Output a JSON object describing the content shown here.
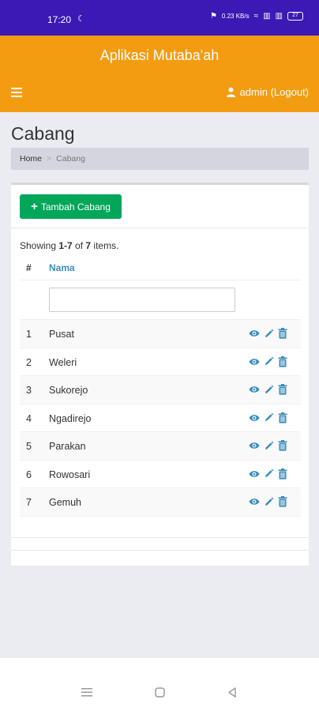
{
  "status_bar": {
    "time": "17:20",
    "net_speed": "0.23 KB/s",
    "battery": "27"
  },
  "header": {
    "app_title": "Aplikasi Mutaba'ah",
    "user_link": "admin (Logout)"
  },
  "page": {
    "title": "Cabang",
    "breadcrumb": {
      "home": "Home",
      "separator": ">",
      "current": "Cabang"
    }
  },
  "toolbar": {
    "add_label": "Tambah Cabang"
  },
  "summary": {
    "prefix": "Showing ",
    "range": "1-7",
    "of": " of ",
    "total": "7",
    "suffix": " items."
  },
  "table": {
    "headers": {
      "num": "#",
      "name": "Nama"
    },
    "filter_value": "",
    "rows": [
      {
        "num": "1",
        "name": "Pusat"
      },
      {
        "num": "2",
        "name": "Weleri"
      },
      {
        "num": "3",
        "name": "Sukorejo"
      },
      {
        "num": "4",
        "name": "Ngadirejo"
      },
      {
        "num": "5",
        "name": "Parakan"
      },
      {
        "num": "6",
        "name": "Rowosari"
      },
      {
        "num": "7",
        "name": "Gemuh"
      }
    ]
  },
  "colors": {
    "status_bar": "#3a19b4",
    "header": "#f39c12",
    "add_button": "#00a65a",
    "link": "#3c8dbc"
  },
  "icons": {
    "view": "eye-icon",
    "edit": "pencil-icon",
    "delete": "trash-icon",
    "menu": "hamburger-icon",
    "user": "user-icon"
  }
}
